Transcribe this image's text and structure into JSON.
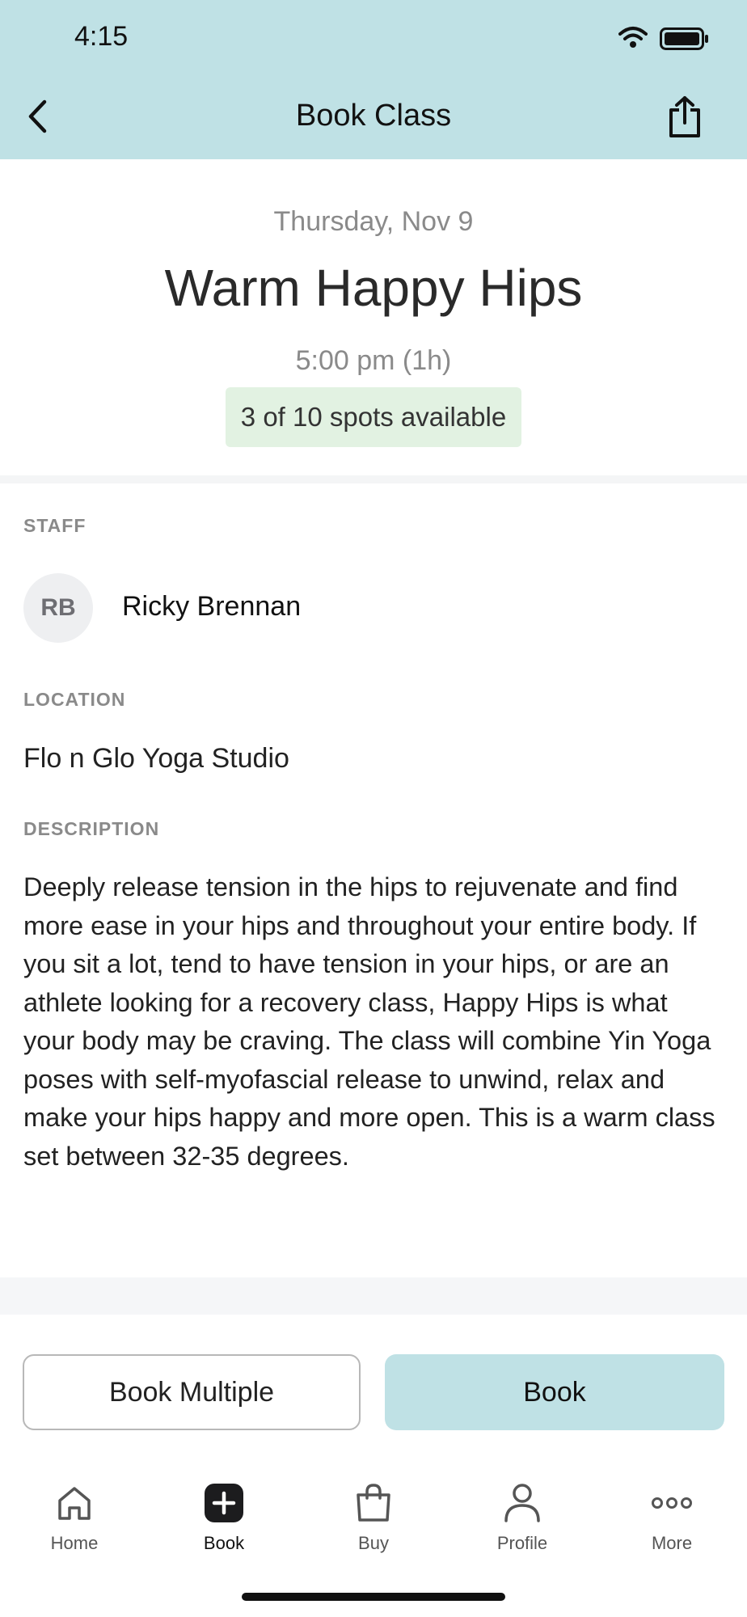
{
  "status_bar": {
    "time": "4:15"
  },
  "header": {
    "title": "Book Class",
    "back_icon": "chevron-left-icon",
    "share_icon": "share-icon"
  },
  "class": {
    "date": "Thursday, Nov 9",
    "name": "Warm Happy Hips",
    "time": "5:00 pm (1h)",
    "spots": "3 of 10 spots available"
  },
  "staff": {
    "label": "STAFF",
    "initials": "RB",
    "name": "Ricky Brennan"
  },
  "location": {
    "label": "LOCATION",
    "name": "Flo n Glo Yoga Studio"
  },
  "description": {
    "label": "DESCRIPTION",
    "text": "Deeply release tension in the hips to rejuvenate and find more ease in your hips and throughout your entire body. If you sit a lot, tend to have tension in your hips, or are an athlete looking for a recovery class, Happy Hips is what your body may be craving. The class will combine Yin Yoga poses with self-myofascial release to unwind, relax and make your hips happy and more open. This is a warm class set between 32-35 degrees."
  },
  "actions": {
    "book_multiple": "Book Multiple",
    "book": "Book"
  },
  "tabs": [
    {
      "label": "Home",
      "icon": "home-icon"
    },
    {
      "label": "Book",
      "icon": "plus-square-icon",
      "active": true
    },
    {
      "label": "Buy",
      "icon": "shopping-bag-icon"
    },
    {
      "label": "Profile",
      "icon": "person-icon"
    },
    {
      "label": "More",
      "icon": "more-dots-icon"
    }
  ],
  "colors": {
    "header_bg": "#bfe1e5",
    "spots_bg": "#e2f2e2",
    "book_bg": "#bfe1e5"
  }
}
